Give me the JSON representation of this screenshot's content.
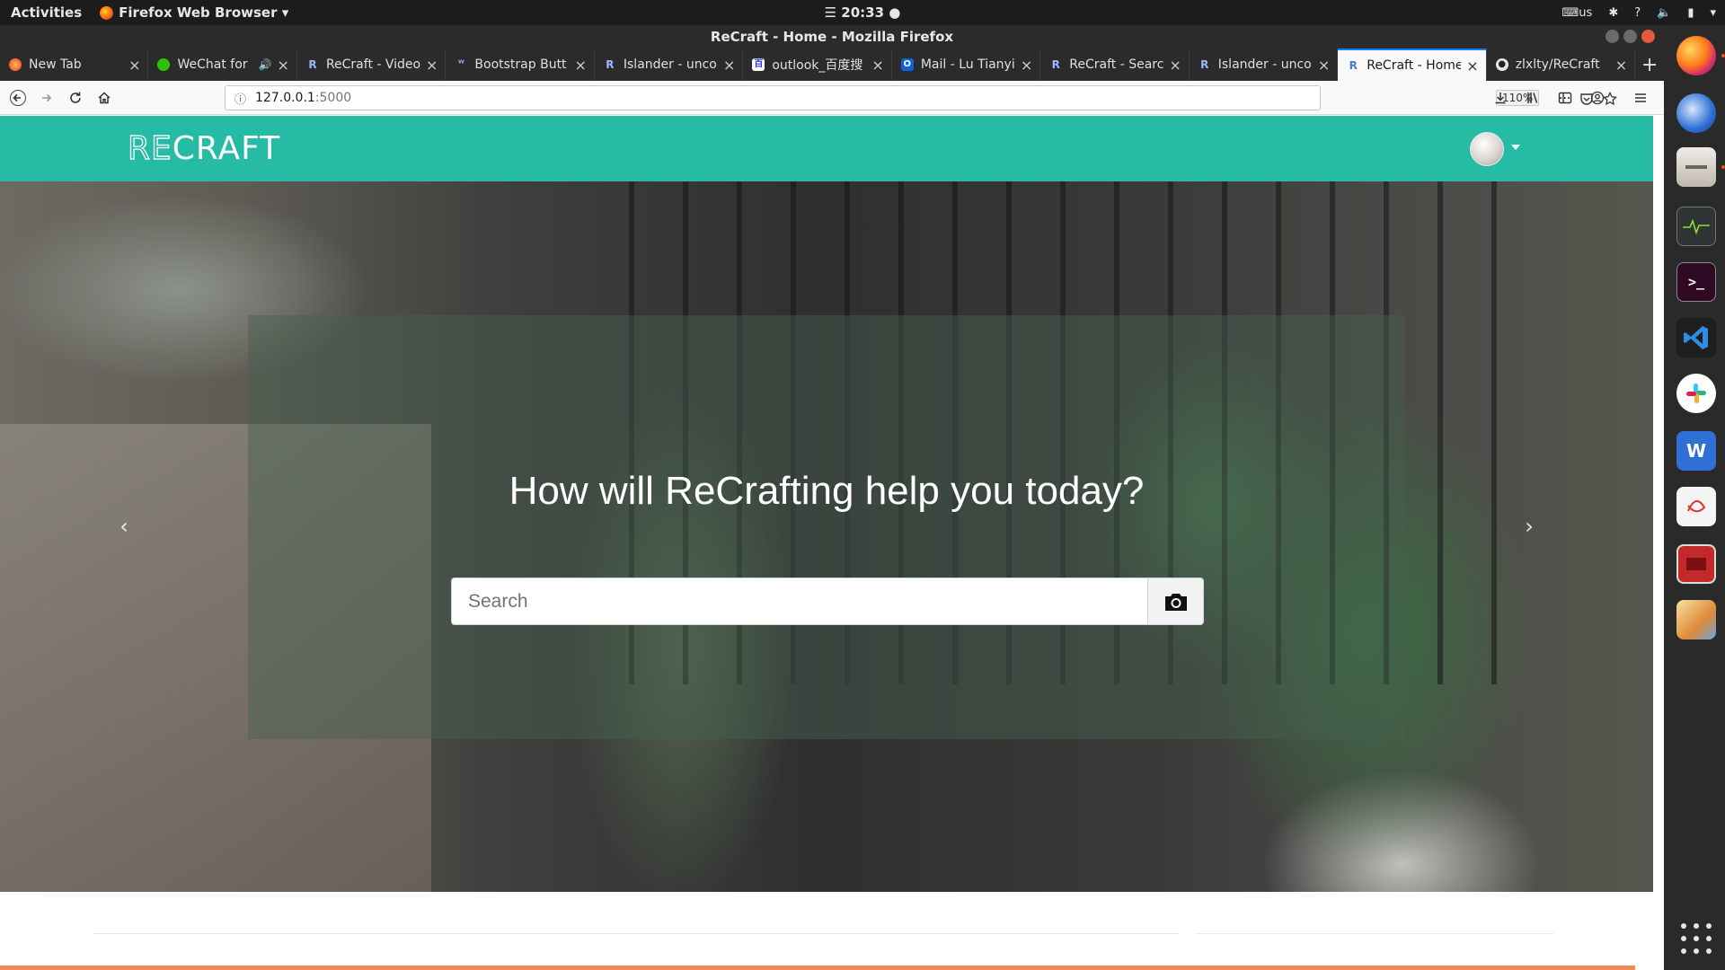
{
  "system_bar": {
    "activities": "Activities",
    "app_menu": "Firefox Web Browser ▾",
    "clock": "☰ 20:33 ●",
    "keyboard": "us",
    "help": "?"
  },
  "window": {
    "title": "ReCraft - Home - Mozilla Firefox"
  },
  "tabs": [
    {
      "label": "New Tab",
      "icon": "firefox-icon",
      "active": false
    },
    {
      "label": "WeChat for",
      "icon": "wechat-icon",
      "active": false,
      "audio": true
    },
    {
      "label": "ReCraft - Video",
      "icon": "r-icon",
      "active": false
    },
    {
      "label": "Bootstrap Butt",
      "icon": "bootstrap-icon",
      "active": false
    },
    {
      "label": "Islander - uncon",
      "icon": "r-icon",
      "active": false
    },
    {
      "label": "outlook_百度搜",
      "icon": "baidu-icon",
      "active": false
    },
    {
      "label": "Mail - Lu Tianyi",
      "icon": "outlook-icon",
      "active": false
    },
    {
      "label": "ReCraft - Searc",
      "icon": "r-icon",
      "active": false
    },
    {
      "label": "Islander - uncon",
      "icon": "r-icon",
      "active": false
    },
    {
      "label": "ReCraft - Home",
      "icon": "r-icon",
      "active": true
    },
    {
      "label": "zlxlty/ReCraft",
      "icon": "github-icon",
      "active": false
    }
  ],
  "navbar": {
    "url_host": "127.0.0.1",
    "url_port": ":5000",
    "zoom": "110%",
    "more": "···"
  },
  "site": {
    "logo_thin": "RE",
    "logo_bold": "CRAFT",
    "headline": "How will ReCrafting help you today?",
    "search_placeholder": "Search",
    "prev_arrow": "‹",
    "next_arrow": "›",
    "colors": {
      "nav_bg": "#26bba4",
      "accent_strip": "#f08a5d"
    }
  },
  "dock": [
    {
      "name": "firefox-icon",
      "label": ""
    },
    {
      "name": "thunderbird-icon",
      "label": ""
    },
    {
      "name": "files-icon",
      "label": ""
    },
    {
      "name": "system-monitor-icon",
      "label": ""
    },
    {
      "name": "terminal-icon",
      "label": ">_"
    },
    {
      "name": "vscode-icon",
      "label": ""
    },
    {
      "name": "slack-icon",
      "label": ""
    },
    {
      "name": "wps-writer-icon",
      "label": "W"
    },
    {
      "name": "wps-pdf-icon",
      "label": ""
    },
    {
      "name": "wps-presentation-icon",
      "label": ""
    },
    {
      "name": "image-viewer-icon",
      "label": ""
    }
  ]
}
